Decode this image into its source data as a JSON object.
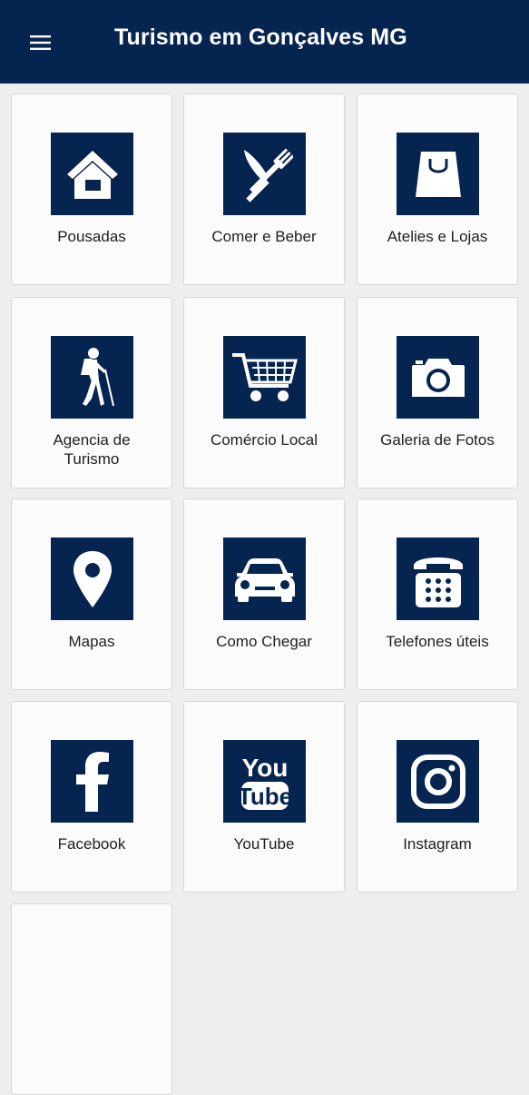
{
  "appbar": {
    "title": "Turismo em Gonçalves MG",
    "menu_icon": "hamburger-menu-icon",
    "background": "#062450"
  },
  "theme": {
    "icon_box_color": "#062450",
    "tile_background": "#fbfbfb",
    "page_background": "#eeeeee"
  },
  "tiles": [
    {
      "label": "Pousadas",
      "icon": "house-icon"
    },
    {
      "label": "Comer e Beber",
      "icon": "fork-knife-icon"
    },
    {
      "label": "Atelies e Lojas",
      "icon": "shopping-bag-icon"
    },
    {
      "label": "Agencia de Turismo",
      "icon": "hiker-icon"
    },
    {
      "label": "Comércio Local",
      "icon": "shopping-cart-icon"
    },
    {
      "label": "Galeria de Fotos",
      "icon": "camera-icon"
    },
    {
      "label": "Mapas",
      "icon": "map-pin-icon"
    },
    {
      "label": "Como Chegar",
      "icon": "car-icon"
    },
    {
      "label": "Telefones úteis",
      "icon": "telephone-icon"
    },
    {
      "label": "Facebook",
      "icon": "facebook-icon"
    },
    {
      "label": "YouTube",
      "icon": "youtube-icon"
    },
    {
      "label": "Instagram",
      "icon": "instagram-icon"
    }
  ]
}
